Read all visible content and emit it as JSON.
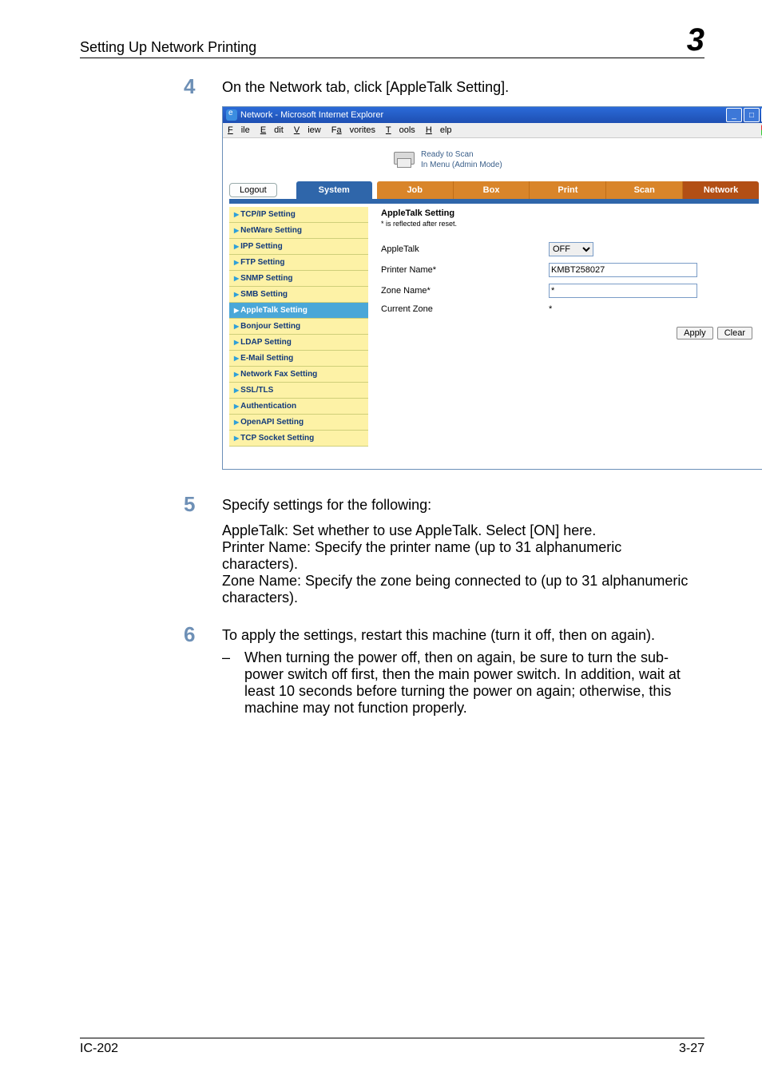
{
  "header": {
    "title": "Setting Up Network Printing",
    "chapter_number": "3"
  },
  "steps": {
    "s4": {
      "num": "4",
      "text": "On the Network tab, click [AppleTalk Setting]."
    },
    "s5": {
      "num": "5",
      "text": "Specify settings for the following:",
      "sub1": "AppleTalk: Set whether to use AppleTalk. Select [ON] here.",
      "sub2": "Printer Name: Specify the printer name (up to 31 alphanumeric characters).",
      "sub3": "Zone Name: Specify the zone being connected to (up to 31 alphanumeric characters)."
    },
    "s6": {
      "num": "6",
      "text": "To apply the settings, restart this machine (turn it off, then on again).",
      "bullet_dash": "–",
      "bullet_text": "When turning the power off, then on again, be sure to turn the sub-power switch off first, then the main power switch. In addition, wait at least 10 seconds before turning the power on again; otherwise, this machine may not function properly."
    }
  },
  "screenshot": {
    "window_title": "Network - Microsoft Internet Explorer",
    "menu": {
      "file": "File",
      "edit": "Edit",
      "view": "View",
      "favorites": "Favorites",
      "tools": "Tools",
      "help": "Help"
    },
    "status1": "Ready to Scan",
    "status2": "In Menu (Admin Mode)",
    "logout": "Logout",
    "tabs": {
      "system": "System",
      "job": "Job",
      "box": "Box",
      "print": "Print",
      "scan": "Scan",
      "network": "Network"
    },
    "nav": [
      "TCP/IP Setting",
      "NetWare Setting",
      "IPP Setting",
      "FTP Setting",
      "SNMP Setting",
      "SMB Setting",
      "AppleTalk Setting",
      "Bonjour Setting",
      "LDAP Setting",
      "E-Mail Setting",
      "Network Fax Setting",
      "SSL/TLS",
      "Authentication",
      "OpenAPI Setting",
      "TCP Socket Setting"
    ],
    "pane": {
      "title": "AppleTalk Setting",
      "note": "* is reflected after reset.",
      "row_appletalk": "AppleTalk",
      "row_printer": "Printer Name*",
      "row_zone": "Zone Name*",
      "row_current": "Current Zone",
      "val_appletalk": "OFF",
      "val_printer": "KMBT258027",
      "val_zone": "*",
      "val_current": "*",
      "apply": "Apply",
      "clear": "Clear"
    }
  },
  "footer": {
    "left": "IC-202",
    "right": "3-27"
  }
}
